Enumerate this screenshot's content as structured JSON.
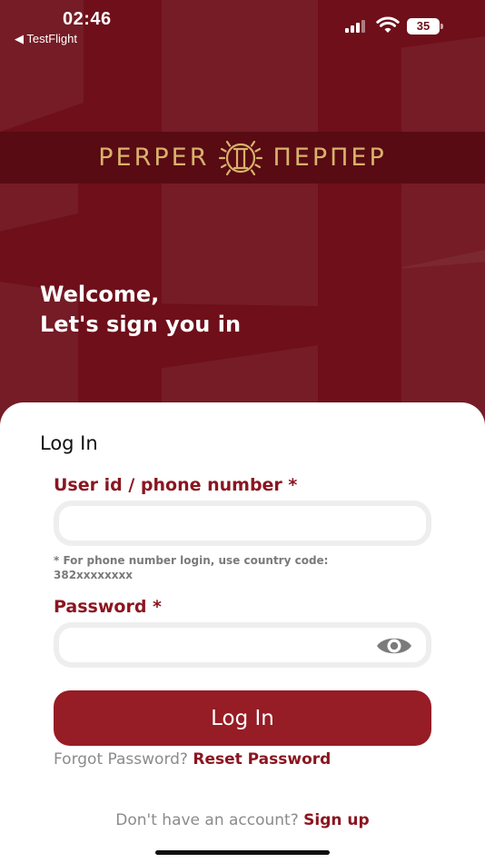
{
  "status_bar": {
    "time": "02:46",
    "back_app": "◀ TestFlight",
    "battery": "35"
  },
  "brand": {
    "left_text": "PERPER",
    "right_text": "ПЕРПЕР",
    "logo_icon": "sun-pillars-logo",
    "gold_color": "#d8b26c"
  },
  "welcome": {
    "line1": "Welcome,",
    "line2": "Let's sign you in"
  },
  "login_form": {
    "title": "Log In",
    "user_label": "User id / phone number *",
    "user_value": "",
    "hint": "* For phone number login, use country code: 382xxxxxxxx",
    "password_label": "Password *",
    "password_value": "",
    "toggle_icon": "eye-icon",
    "submit_label": "Log In",
    "forgot_text": "Forgot Password?",
    "reset_link": "Reset Password",
    "signup_text": "Don't have an account?",
    "signup_link": "Sign up"
  },
  "colors": {
    "background": "#6e0f1a",
    "accent": "#961c25",
    "label": "#8a1620",
    "muted_text": "#8b8b8b"
  }
}
